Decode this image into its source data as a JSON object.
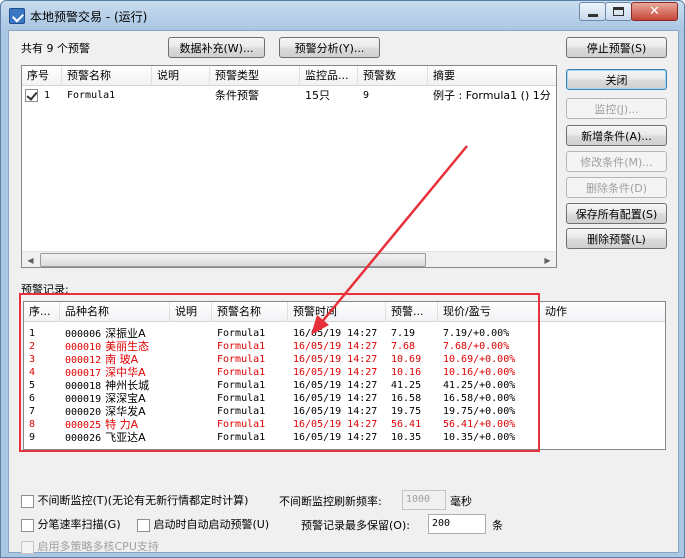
{
  "window": {
    "title": "本地预警交易 - (运行)",
    "accent_red": "#e8303a"
  },
  "top": {
    "count_label": "共有 9 个预警",
    "data_fill_button": "数据补充(W)...",
    "analysis_button": "预警分析(Y)...",
    "stop_button": "停止预警(S)"
  },
  "alert_list": {
    "columns": [
      "序号",
      "预警名称",
      "说明",
      "预警类型",
      "监控品...",
      "预警数",
      "摘要"
    ],
    "rows": [
      {
        "checked": true,
        "no": "1",
        "name": "Formula1",
        "desc": "",
        "type": "条件预警",
        "monitor": "15只",
        "count": "9",
        "summary": "例子 : Formula1 () 1分"
      }
    ]
  },
  "side_buttons": {
    "close": "关闭",
    "monitor": "监控(J)...",
    "add_condition": "新增条件(A)...",
    "edit_condition": "修改条件(M)...",
    "delete_condition": "删除条件(D)",
    "save_config": "保存所有配置(S)",
    "delete_alert": "删除预警(L)"
  },
  "records": {
    "label": "预警记录:",
    "columns": [
      "序...",
      "品种名称",
      "说明",
      "预警名称",
      "预警时间",
      "预警...",
      "现价/盈亏",
      "动作"
    ],
    "rows": [
      {
        "no": "1",
        "code": "000006",
        "name": "深振业A",
        "desc": "",
        "alert": "Formula1",
        "time": "16/05/19 14:27",
        "price": "7.19",
        "pnl": "7.19/+0.00%",
        "red": false
      },
      {
        "no": "2",
        "code": "000010",
        "name": "美丽生态",
        "desc": "",
        "alert": "Formula1",
        "time": "16/05/19 14:27",
        "price": "7.68",
        "pnl": "7.68/+0.00%",
        "red": true
      },
      {
        "no": "3",
        "code": "000012",
        "name": "南  玻A",
        "desc": "",
        "alert": "Formula1",
        "time": "16/05/19 14:27",
        "price": "10.69",
        "pnl": "10.69/+0.00%",
        "red": true
      },
      {
        "no": "4",
        "code": "000017",
        "name": "深中华A",
        "desc": "",
        "alert": "Formula1",
        "time": "16/05/19 14:27",
        "price": "10.16",
        "pnl": "10.16/+0.00%",
        "red": true
      },
      {
        "no": "5",
        "code": "000018",
        "name": "神州长城",
        "desc": "",
        "alert": "Formula1",
        "time": "16/05/19 14:27",
        "price": "41.25",
        "pnl": "41.25/+0.00%",
        "red": false
      },
      {
        "no": "6",
        "code": "000019",
        "name": "深深宝A",
        "desc": "",
        "alert": "Formula1",
        "time": "16/05/19 14:27",
        "price": "16.58",
        "pnl": "16.58/+0.00%",
        "red": false
      },
      {
        "no": "7",
        "code": "000020",
        "name": "深华发A",
        "desc": "",
        "alert": "Formula1",
        "time": "16/05/19 14:27",
        "price": "19.75",
        "pnl": "19.75/+0.00%",
        "red": false
      },
      {
        "no": "8",
        "code": "000025",
        "name": "特  力A",
        "desc": "",
        "alert": "Formula1",
        "time": "16/05/19 14:27",
        "price": "56.41",
        "pnl": "56.41/+0.00%",
        "red": true
      },
      {
        "no": "9",
        "code": "000026",
        "name": "飞亚达A",
        "desc": "",
        "alert": "Formula1",
        "time": "16/05/19 14:27",
        "price": "10.35",
        "pnl": "10.35/+0.00%",
        "red": false
      }
    ]
  },
  "options": {
    "continuous_label": "不间断监控(T)(无论有无新行情都定时计算)",
    "refresh_label": "不间断监控刷新频率:",
    "refresh_value": "1000",
    "refresh_unit": "毫秒",
    "tick_scan_label": "分笔速率扫描(G)",
    "auto_start_label": "启动时自动启动预警(U)",
    "max_records_label": "预警记录最多保留(O):",
    "max_records_value": "200",
    "max_records_unit": "条",
    "multi_cpu_label": "启用多策略多核CPU支持"
  }
}
